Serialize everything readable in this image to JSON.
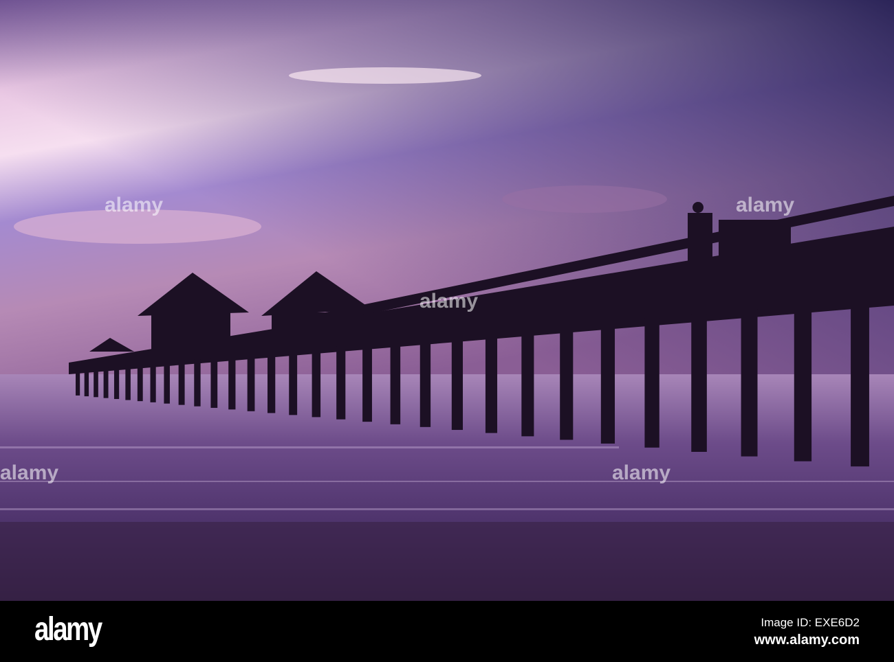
{
  "footer": {
    "logo": "alamy",
    "image_id": "Image ID: EXE6D2",
    "website": "www.alamy.com"
  },
  "watermark": "alamy",
  "colors": {
    "sky_top": "#3a2a63",
    "sky_glow": "#f3d5e6",
    "water": "#6b4a8a",
    "pier": "#1a0f22"
  }
}
